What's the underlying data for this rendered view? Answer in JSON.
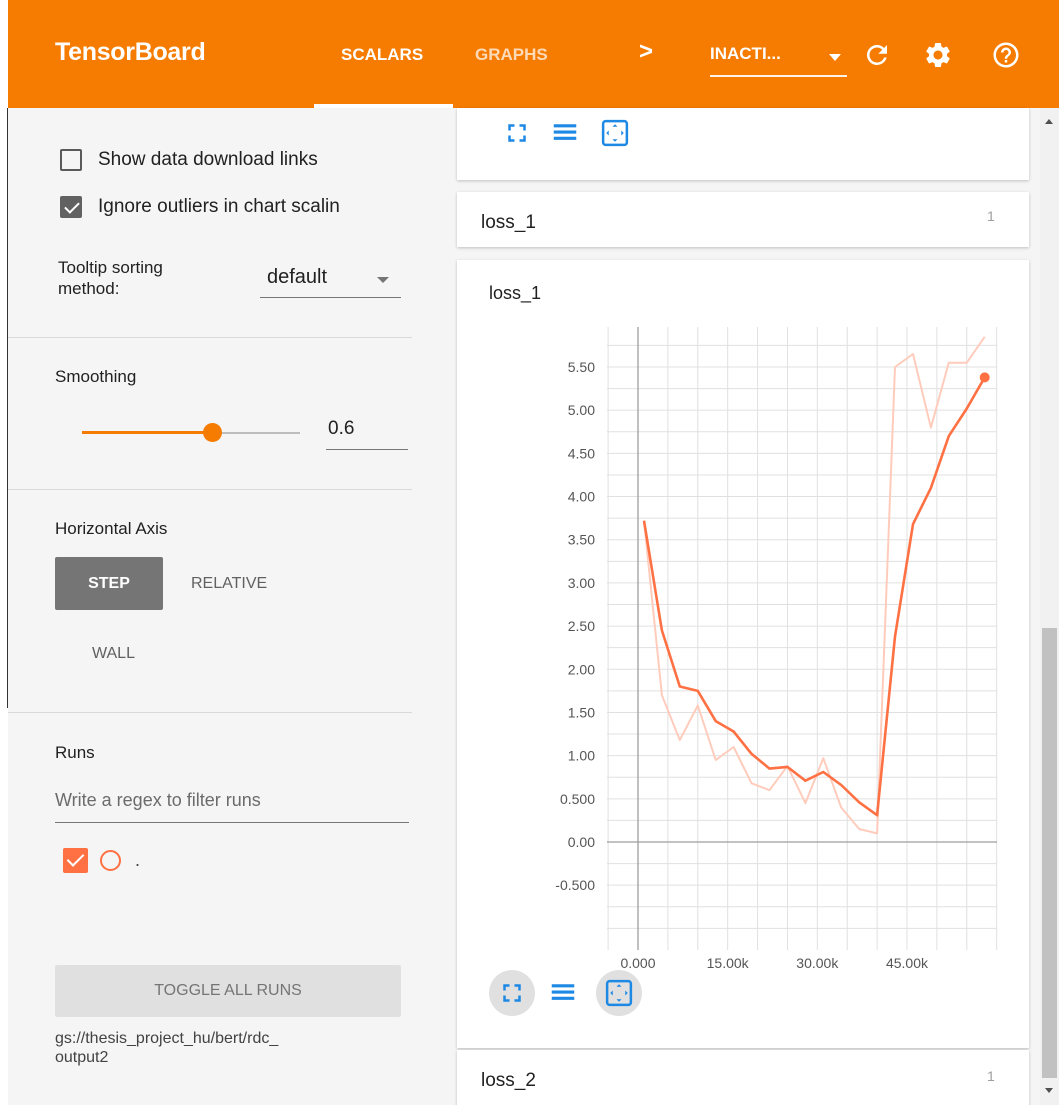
{
  "header": {
    "brand": "TensorBoard",
    "tabs": [
      {
        "label": "SCALARS",
        "active": true
      },
      {
        "label": "GRAPHS",
        "active": false
      }
    ],
    "more_icon": "chevron-right",
    "inactive_select": "INACTI...",
    "icons": [
      "refresh-icon",
      "settings-icon",
      "help-icon"
    ],
    "color": "#f57c00"
  },
  "sidebar": {
    "show_download_links": {
      "label": "Show data download links",
      "checked": false
    },
    "ignore_outliers": {
      "label": "Ignore outliers in chart scalin",
      "checked": true
    },
    "tooltip_sorting": {
      "label_line1": "Tooltip sorting",
      "label_line2": "method:",
      "value": "default"
    },
    "smoothing": {
      "label": "Smoothing",
      "value": "0.6",
      "level": 0.6
    },
    "horizontal_axis": {
      "label": "Horizontal Axis",
      "options": [
        "STEP",
        "RELATIVE",
        "WALL"
      ],
      "selected": "STEP"
    },
    "runs": {
      "label": "Runs",
      "filter_placeholder": "Write a regex to filter runs",
      "items": [
        {
          "name": ".",
          "checked": true,
          "color": "#ff7043"
        }
      ],
      "toggle_label": "TOGGLE ALL RUNS",
      "logdir_line1": "gs://thesis_project_hu/bert/rdc_",
      "logdir_line2": "output2"
    }
  },
  "cards": {
    "loss_1": {
      "title": "loss_1",
      "count": "1",
      "chart_title": "loss_1"
    },
    "loss_2": {
      "title": "loss_2",
      "count": "1"
    }
  },
  "chart_data": {
    "type": "line",
    "title": "loss_1",
    "xlabel": "",
    "ylabel": "",
    "x_ticks": [
      "0.000",
      "15.00k",
      "30.00k",
      "45.00k"
    ],
    "y_ticks": [
      "5.50",
      "5.00",
      "4.50",
      "4.00",
      "3.50",
      "3.00",
      "2.50",
      "2.00",
      "1.50",
      "1.00",
      "0.500",
      "0.00",
      "-0.500"
    ],
    "xlim": [
      -5000,
      60000
    ],
    "ylim": [
      -1.0,
      6.2
    ],
    "grid": true,
    "series": [
      {
        "role": "raw",
        "color": "#ffccbc",
        "x": [
          1000,
          4000,
          7000,
          10000,
          13000,
          16000,
          19000,
          22000,
          25000,
          28000,
          31000,
          34000,
          37000,
          40000,
          43000,
          46000,
          49000,
          52000,
          55000,
          58000
        ],
        "y": [
          3.72,
          1.7,
          1.18,
          1.58,
          0.95,
          1.1,
          0.68,
          0.6,
          0.88,
          0.45,
          0.97,
          0.4,
          0.15,
          0.1,
          5.5,
          5.65,
          4.8,
          5.55,
          5.55,
          5.85
        ]
      },
      {
        "role": "smoothed",
        "color": "#ff7043",
        "x": [
          1000,
          4000,
          7000,
          10000,
          13000,
          16000,
          19000,
          22000,
          25000,
          28000,
          31000,
          34000,
          37000,
          40000,
          43000,
          46000,
          49000,
          52000,
          55000,
          58000
        ],
        "y": [
          3.72,
          2.45,
          1.8,
          1.75,
          1.4,
          1.28,
          1.02,
          0.85,
          0.87,
          0.71,
          0.81,
          0.66,
          0.46,
          0.31,
          2.38,
          3.68,
          4.1,
          4.7,
          5.02,
          5.38
        ]
      }
    ]
  }
}
